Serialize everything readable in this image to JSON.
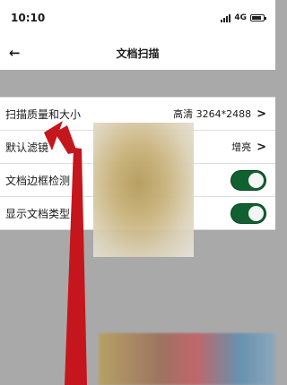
{
  "status_bar": {
    "time": "10:10",
    "network": "4G",
    "battery_level": 0.85
  },
  "header": {
    "back_icon": "arrow-left-icon",
    "title": "文档扫描"
  },
  "settings": [
    {
      "label": "扫描质量和大小",
      "value": "高清 3264*2488",
      "type": "link"
    },
    {
      "label": "默认滤镜",
      "value": "增亮",
      "type": "link"
    },
    {
      "label": "文档边框检测",
      "type": "toggle",
      "enabled": true
    },
    {
      "label": "显示文档类型",
      "type": "toggle",
      "enabled": true
    }
  ],
  "annotation": {
    "type": "red-arrow",
    "color": "#c4161c",
    "points_to": "扫描质量和大小"
  }
}
